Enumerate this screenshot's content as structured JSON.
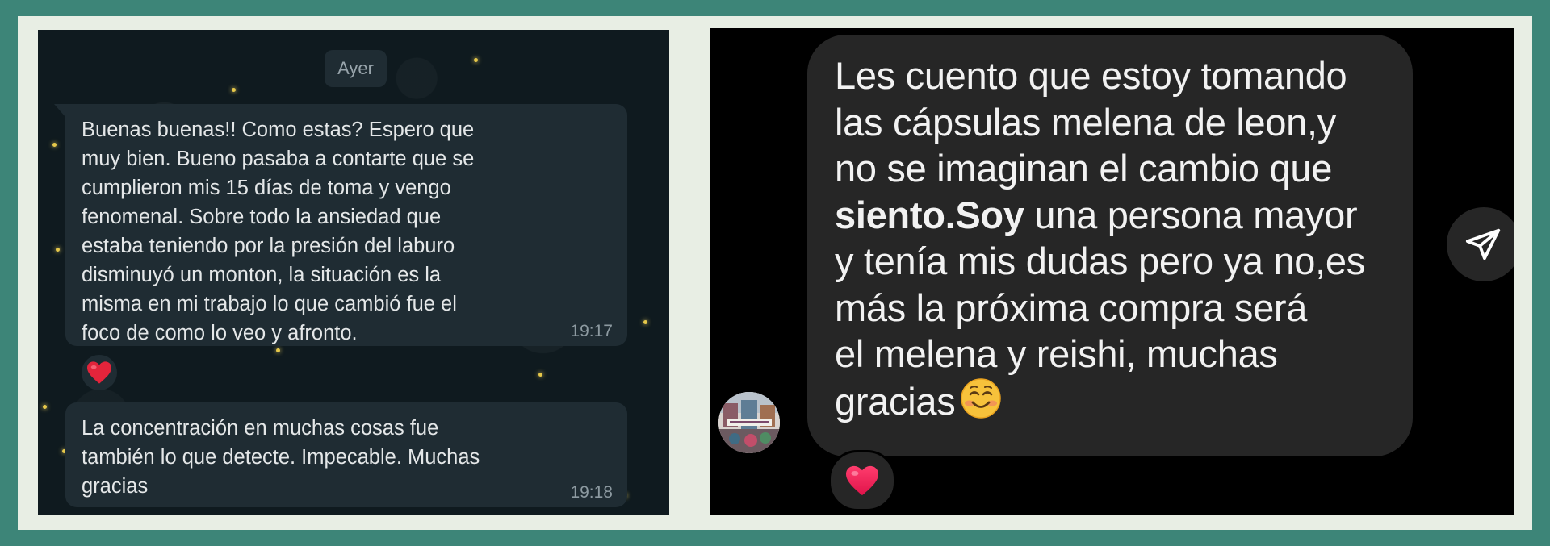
{
  "left_chat": {
    "date_chip": "Ayer",
    "messages": [
      {
        "text": "Buenas buenas!! Como estas? Espero que\nmuy bien. Bueno pasaba a contarte que se\ncumplieron mis 15 días de toma y vengo\nfenomenal. Sobre todo la ansiedad que\nestaba teniendo por la presión del laburo\ndisminuyó un monton, la situación es la\nmisma en mi trabajo lo que cambió fue el\nfoco de como lo veo y afronto.",
        "time": "19:17",
        "reaction": "heart-emoji"
      },
      {
        "text": "La concentración en muchas cosas fue\ntambién lo que detecte. Impecable. Muchas\ngracias",
        "time": "19:18"
      }
    ]
  },
  "right_chat": {
    "message": {
      "line1": "Les cuento que estoy tomando",
      "line2": "las cápsulas melena de leon,y",
      "line3": "no se imaginan el cambio que",
      "line4_bold": "siento.Soy",
      "line4_rest": " una persona mayor",
      "line5": "y tenía mis dudas pero ya no,es",
      "line6": "más la próxima compra será",
      "line7": "el melena y reishi, muchas",
      "line8": "gracias",
      "emoji": "smiling-face-emoji"
    },
    "reaction": "heart-emoji",
    "avatar": "user-avatar",
    "send_icon": "send-icon"
  },
  "colors": {
    "outer_border": "#3d8578",
    "inner_frame": "#e8eee4",
    "wa_background": "#0f1a1f",
    "wa_bubble": "#1f2c33",
    "ig_background": "#000000",
    "ig_bubble": "#262626"
  }
}
